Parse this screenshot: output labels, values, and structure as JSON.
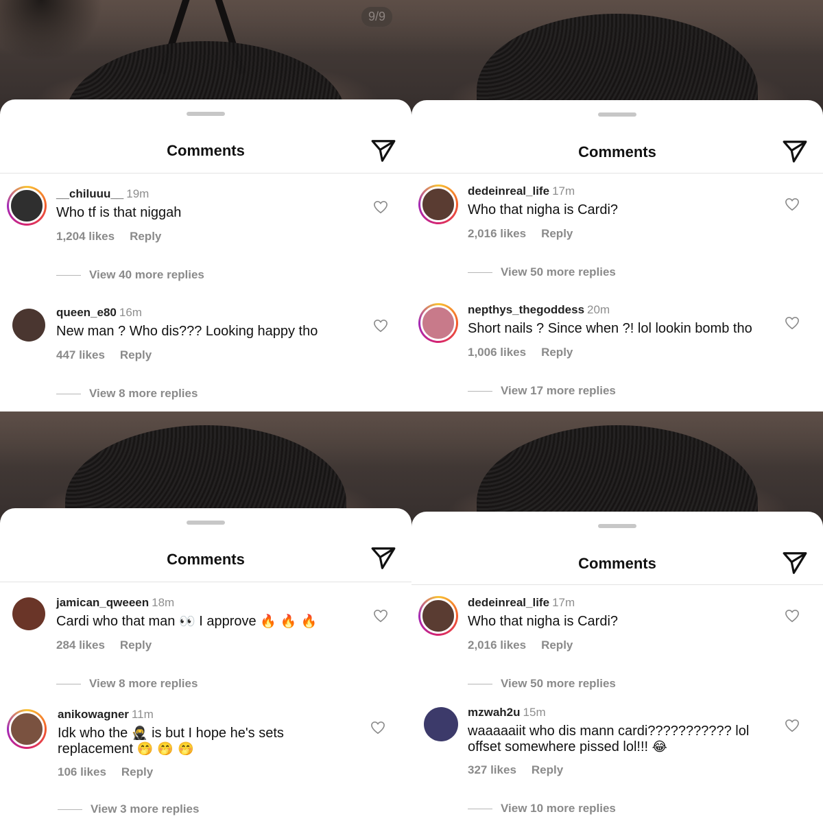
{
  "panels": [
    {
      "counter": "9/9",
      "title": "Comments",
      "comments": [
        {
          "username": "__chiluuu__",
          "time": "19m",
          "text": "Who tf is that niggah",
          "likes": "1,204 likes",
          "reply": "Reply",
          "view_replies": "View 40 more replies",
          "avatar_color": "#3a3a3a",
          "story_ring": true
        },
        {
          "username": "queen_e80",
          "time": "16m",
          "text": "New man ? Who dis??? Looking happy tho",
          "likes": "447 likes",
          "reply": "Reply",
          "view_replies": "View 8 more replies",
          "avatar_color": "#4a3630",
          "story_ring": false
        }
      ]
    },
    {
      "title": "Comments",
      "comments": [
        {
          "username": "dedeinreal_life",
          "time": "17m",
          "text": "Who that nigha is Cardi?",
          "likes": "2,016 likes",
          "reply": "Reply",
          "view_replies": "View 50 more replies",
          "avatar_color": "#5a3c32",
          "story_ring": true
        },
        {
          "username": "nepthys_thegoddess",
          "time": "20m",
          "text": "Short nails ? Since when ?! lol lookin bomb tho",
          "likes": "1,006 likes",
          "reply": "Reply",
          "view_replies": "View 17 more replies",
          "avatar_color": "#c87a8a",
          "story_ring": true
        }
      ]
    },
    {
      "title": "Comments",
      "comments": [
        {
          "username": "jamican_qweeen",
          "time": "18m",
          "text": "Cardi who that man",
          "emoji_a": "👀",
          "text_b": "I approve",
          "emoji_b": "🔥 🔥 🔥",
          "likes": "284 likes",
          "reply": "Reply",
          "view_replies": "View 8 more replies",
          "avatar_color": "#6a3528",
          "story_ring": false
        },
        {
          "username": "anikowagner",
          "time": "11m",
          "text": "Idk who the",
          "emoji_a": "🥷",
          "text_b": "is but I hope he's sets replacement",
          "emoji_b": "🤭 🤭 🤭",
          "likes": "106 likes",
          "reply": "Reply",
          "view_replies": "View 3 more replies",
          "avatar_color": "#7a5240",
          "story_ring": true
        }
      ]
    },
    {
      "title": "Comments",
      "comments": [
        {
          "username": "dedeinreal_life",
          "time": "17m",
          "text": "Who that nigha is Cardi?",
          "likes": "2,016 likes",
          "reply": "Reply",
          "view_replies": "View 50 more replies",
          "avatar_color": "#5a3c32",
          "story_ring": true
        },
        {
          "username": "mzwah2u",
          "time": "15m",
          "text": "waaaaaiit who dis mann cardi??????????? lol offset somewhere pissed lol!!!",
          "emoji_b": "😂",
          "likes": "327 likes",
          "reply": "Reply",
          "view_replies": "View 10 more replies",
          "avatar_color": "#3c3a6a",
          "story_ring": false
        }
      ]
    }
  ]
}
